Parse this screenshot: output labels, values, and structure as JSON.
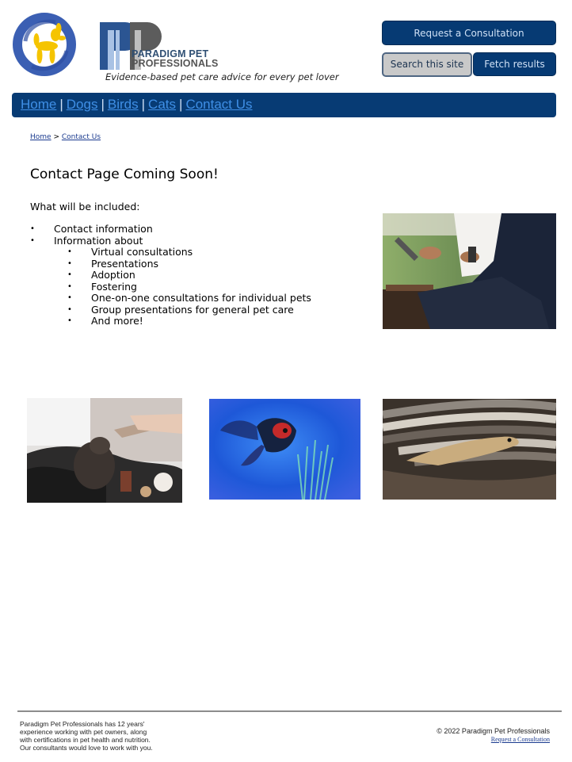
{
  "header": {
    "brand_line1": "PARADIGM PET",
    "brand_line2": "PROFESSIONALS",
    "tagline": "Evidence-based pet care advice for every pet lover",
    "request_button": "Request a Consultation",
    "search_button": "Search this site",
    "fetch_button": "Fetch results"
  },
  "nav": {
    "items": [
      "Home",
      "Dogs",
      "Birds",
      "Cats",
      "Contact Us"
    ],
    "separator": "|"
  },
  "breadcrumb": {
    "home": "Home",
    "separator": ">",
    "current": "Contact Us"
  },
  "main": {
    "title": "Contact Page Coming Soon!",
    "subtitle": "What will be included:",
    "list": [
      "Contact information",
      "Information about"
    ],
    "sublist": [
      "Virtual consultations",
      "Presentations",
      "Adoption",
      "Fostering",
      "One-on-one consultations for individual pets",
      "Group presentations for general pet care",
      "And more!"
    ]
  },
  "footer": {
    "about_lines": [
      "Paradigm Pet Professionals has 12 years'",
      "experience working with pet owners, along",
      "with certifications in pet health and nutrition.",
      "Our consultants would love to work with you."
    ],
    "copyright": "© 2022 Paradigm Pet Professionals",
    "request_link": "Request a Consultation"
  },
  "colors": {
    "nav_bg": "#073b74",
    "nav_link": "#3f8fe6",
    "button_dark": "#063a73",
    "button_grey": "#c9c9c9",
    "logo_blue": "#3b5fb3",
    "logo_yellow": "#f5c400"
  },
  "images": {
    "logo": "balloon-dog-logo",
    "meeting": "consultation-meeting-photo",
    "ferret": "ferret-dropper-photo",
    "fish": "goldfish-photo",
    "snake": "snake-photo"
  }
}
